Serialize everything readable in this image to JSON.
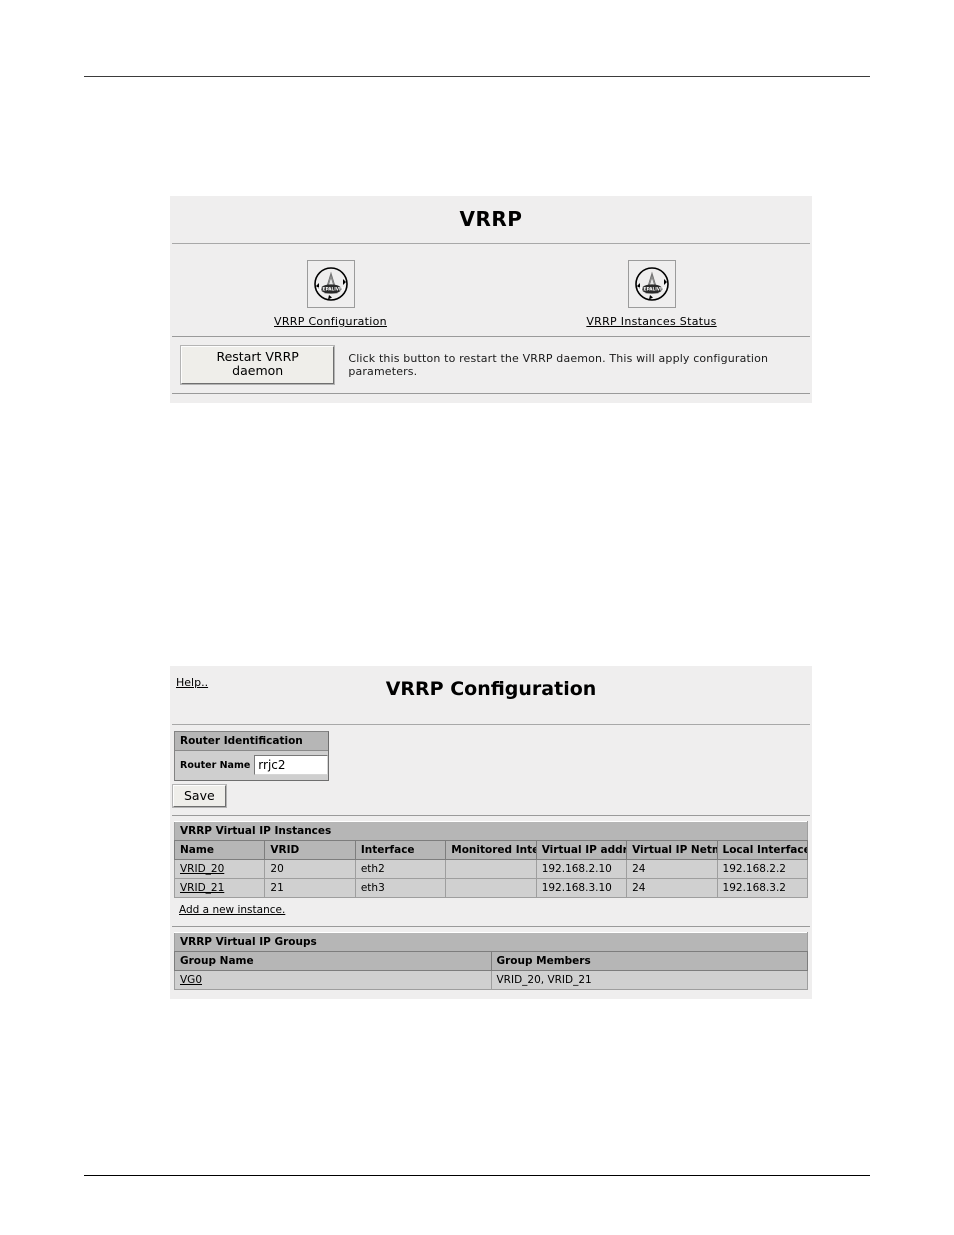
{
  "vrrp_panel": {
    "title": "VRRP",
    "icons": [
      {
        "name": "keepalived-icon",
        "caption": "VRRP Configuration"
      },
      {
        "name": "keepalived-icon",
        "caption": "VRRP Instances Status"
      }
    ],
    "restart_button_label": "Restart VRRP daemon",
    "restart_help_text": "Click this button to restart the VRRP daemon. This will apply configuration parameters."
  },
  "config_panel": {
    "help_label": "Help..",
    "title": "VRRP Configuration",
    "router_identification": {
      "section_label": "Router Identification",
      "router_name_label": "Router Name",
      "router_name_value": "rrjc2",
      "router_name_placeholder": ""
    },
    "save_label": "Save",
    "instances_table": {
      "caption": "VRRP Virtual IP Instances",
      "columns": [
        "Name",
        "VRID",
        "Interface",
        "Monitored Interface",
        "Virtual IP address",
        "Virtual IP Netmask",
        "Local Interface IP"
      ],
      "rows": [
        {
          "name": "VRID_20",
          "vrid": "20",
          "interface": "eth2",
          "monitored_interface": "",
          "virtual_ip_address": "192.168.2.10",
          "virtual_ip_netmask": "24",
          "local_interface_ip": "192.168.2.2"
        },
        {
          "name": "VRID_21",
          "vrid": "21",
          "interface": "eth3",
          "monitored_interface": "",
          "virtual_ip_address": "192.168.3.10",
          "virtual_ip_netmask": "24",
          "local_interface_ip": "192.168.3.2"
        }
      ],
      "add_link_label": "Add a new instance."
    },
    "groups_table": {
      "caption": "VRRP Virtual IP Groups",
      "columns": [
        "Group Name",
        "Group Members"
      ],
      "rows": [
        {
          "group_name": "VG0",
          "group_members": "VRID_20, VRID_21"
        }
      ]
    }
  },
  "icon_text": {
    "keepalived_wordmark": "KEEPALIVED"
  },
  "colors": {
    "panel_bg": "#efeeee",
    "table_header_bg": "#b6b6b6",
    "table_cell_bg": "#d0d0d0",
    "button_bg": "#efeeea",
    "rule": "#3b3b3b"
  }
}
